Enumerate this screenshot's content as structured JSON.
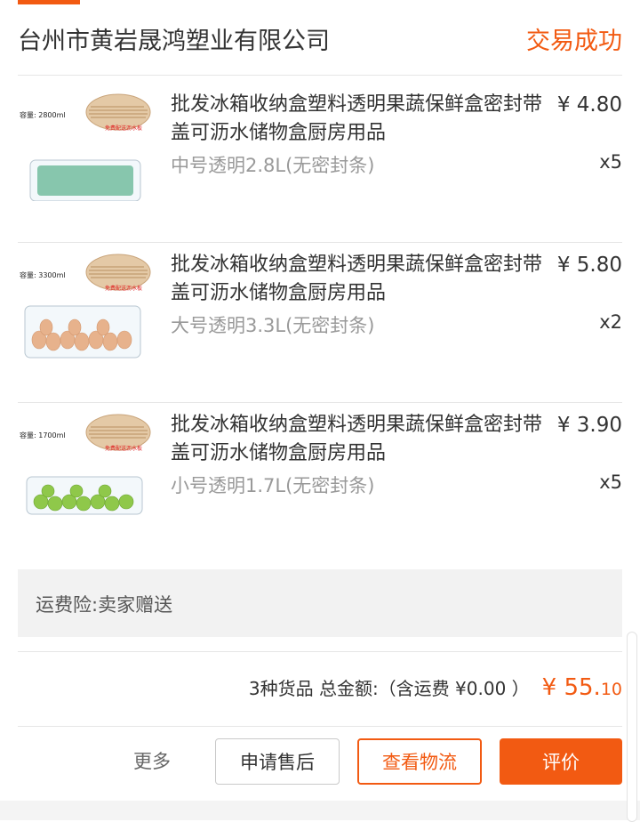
{
  "header": {
    "shop_name": "台州市黄岩晟鸿塑业有限公司",
    "status": "交易成功"
  },
  "items": [
    {
      "capacity_label": "容量: 2800ml",
      "title": "批发冰箱收纳盒塑料透明果蔬保鲜盒密封带盖可沥水储物盒厨房用品",
      "price": "¥ 4.80",
      "spec": "中号透明2.8L(无密封条)",
      "qty": "x5",
      "content_color": "#2e9c6e"
    },
    {
      "capacity_label": "容量: 3300ml",
      "title": "批发冰箱收纳盒塑料透明果蔬保鲜盒密封带盖可沥水储物盒厨房用品",
      "price": "¥ 5.80",
      "spec": "大号透明3.3L(无密封条)",
      "qty": "x2",
      "content_color": "#e7b28c"
    },
    {
      "capacity_label": "容量: 1700ml",
      "title": "批发冰箱收纳盒塑料透明果蔬保鲜盒密封带盖可沥水储物盒厨房用品",
      "price": "¥ 3.90",
      "spec": "小号透明1.7L(无密封条)",
      "qty": "x5",
      "content_color": "#8fc84a"
    }
  ],
  "shipping_insurance": "运费险:卖家赠送",
  "summary": {
    "label": "3种货品 总金额:（含运费 ¥0.00 ）",
    "total_major": "¥ 55.",
    "total_minor": "10"
  },
  "actions": {
    "more": "更多",
    "after_sale": "申请售后",
    "view_logistics": "查看物流",
    "review": "评价"
  },
  "colors": {
    "accent": "#f25a12"
  }
}
